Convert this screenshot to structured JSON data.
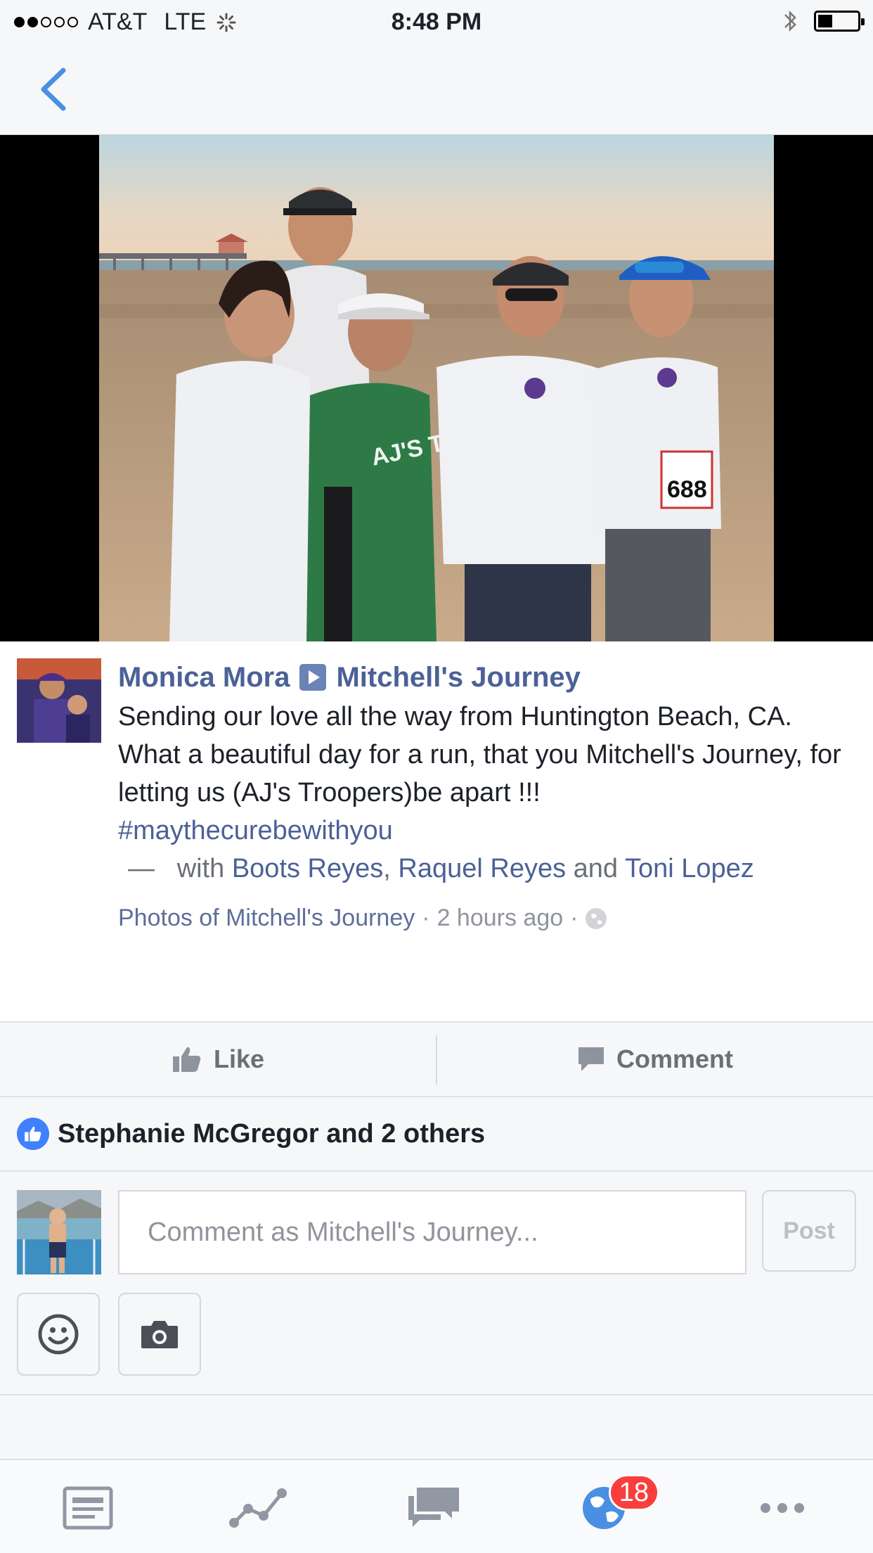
{
  "status_bar": {
    "carrier": "AT&T",
    "network": "LTE",
    "time": "8:48 PM"
  },
  "post": {
    "author": "Monica Mora",
    "target_page": "Mitchell's Journey",
    "text": "Sending our love all the way from Huntington Beach, CA. What a beautiful day for a run, that you Mitchell's Journey, for letting us (AJ's Troopers)be apart !!!",
    "hashtag": "#maythecurebewithyou",
    "with_dash": "—",
    "with_label": "with",
    "tagged": [
      "Boots Reyes",
      "Raquel Reyes",
      "Toni Lopez"
    ],
    "tagged_sep_comma": ",",
    "tagged_sep_and": "and",
    "album": "Photos of Mitchell's Journey",
    "time_ago": "2 hours ago",
    "meta_sep": "·",
    "shirt_text": "AJ'S TROOPERS",
    "bib_text": "688"
  },
  "actions": {
    "like_label": "Like",
    "comment_label": "Comment"
  },
  "likes": {
    "summary": "Stephanie McGregor and 2 others"
  },
  "composer": {
    "placeholder": "Comment as Mitchell's Journey...",
    "post_label": "Post"
  },
  "tabbar": {
    "notifications_count": "18",
    "tabs": [
      "news-feed-icon",
      "insights-icon",
      "messages-icon",
      "notifications-globe-icon",
      "more-icon"
    ]
  },
  "colors": {
    "link": "#4b6197",
    "like_blue": "#4080ff",
    "badge_red": "#fa3e3e",
    "back_blue": "#4a90e2"
  }
}
